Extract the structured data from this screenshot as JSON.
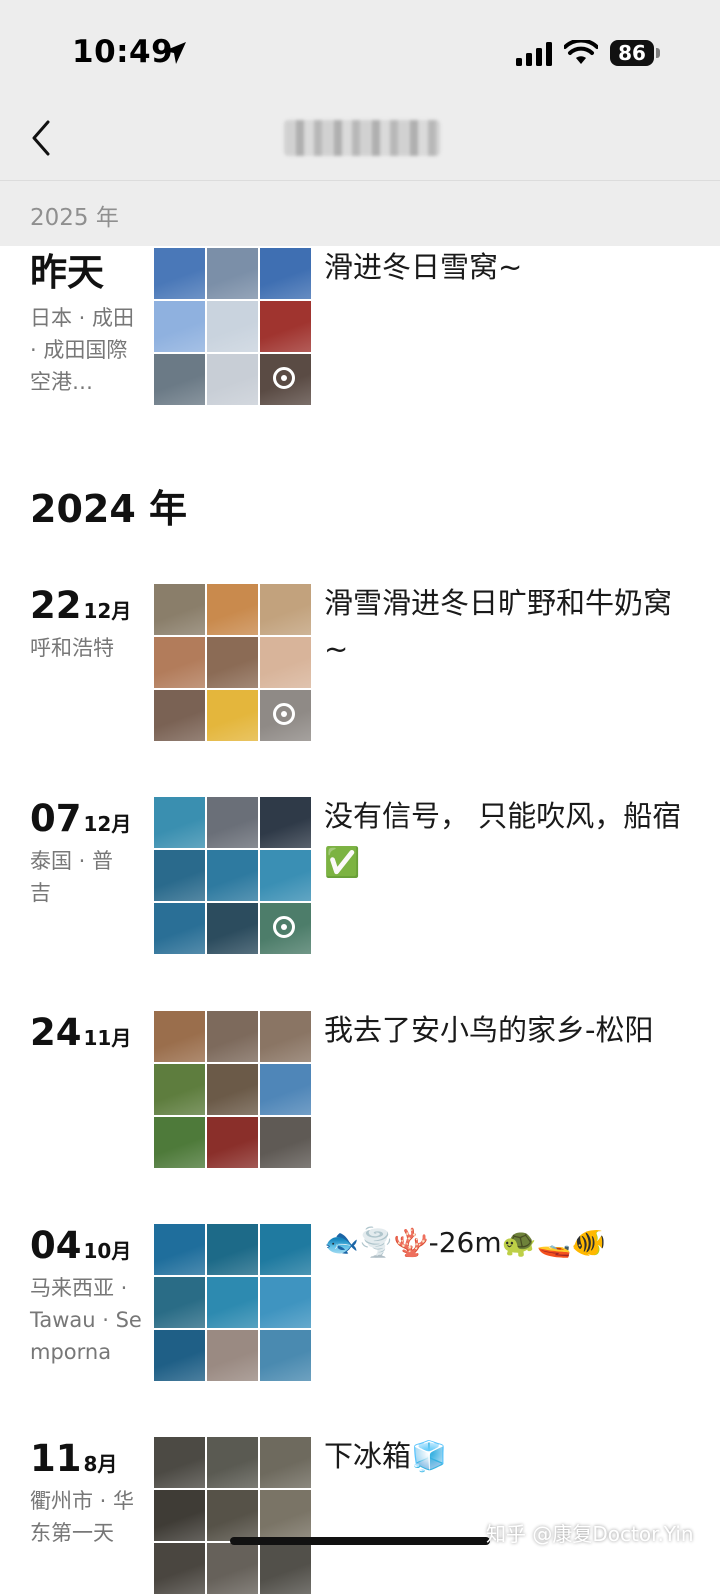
{
  "status_bar": {
    "time": "10:49",
    "battery": "86"
  },
  "nav": {
    "title": ""
  },
  "sticky_year": "2025 年",
  "colors": {
    "nav_background": "#ededed",
    "secondary_text": "#777777",
    "accent_green": "#3bb34a"
  },
  "section_2025": {
    "entries": [
      {
        "label": "昨天",
        "place": "日本 · 成田 · 成田国際空港…",
        "caption": "滑进冬日雪窝~",
        "tiles": [
          "#4a78b8",
          "#7b8fa8",
          "#3f6fb2",
          "#8fb1df",
          "#c9d3de",
          "#a0342f",
          "#6b7a86",
          "#c8ced6",
          "#5a4b44"
        ],
        "live_tile": 8
      }
    ]
  },
  "section_2024": {
    "year": "2024 年",
    "entries": [
      {
        "day": "22",
        "month": "12月",
        "place": "呼和浩特",
        "caption": "滑雪滑进冬日旷野和牛奶窝~",
        "tiles": [
          "#8a7e6a",
          "#c98a4d",
          "#c2a27d",
          "#b27c5b",
          "#8b6b55",
          "#d8b49a",
          "#7a6254",
          "#e4b63c",
          "#8f8a86"
        ],
        "live_tile": 8
      },
      {
        "day": "07",
        "month": "12月",
        "place": "泰国 · 普吉",
        "caption": "没有信号， 只能吹风，船宿✅",
        "tiles": [
          "#3a8fb0",
          "#6a6f78",
          "#2f3a48",
          "#2a6a8c",
          "#2e7aa0",
          "#3a8fb4",
          "#2a6f96",
          "#2c4c5e",
          "#4d7d6a"
        ],
        "live_tile": 8
      },
      {
        "day": "24",
        "month": "11月",
        "place": "",
        "caption": "我去了安小鸟的家乡-松阳",
        "tiles": [
          "#9a6e4c",
          "#7d6a5c",
          "#8a7564",
          "#5e7d3e",
          "#6b5a48",
          "#4f86b8",
          "#4e7a3a",
          "#8a2f2a",
          "#5f5a55"
        ],
        "live_tile": null
      },
      {
        "day": "04",
        "month": "10月",
        "place": "马来西亚 · Tawau · Semporna",
        "caption": "🐟🌪️🪸-26m🐢🚤🐠",
        "tiles": [
          "#1f6e9c",
          "#1d6a88",
          "#1f7aa0",
          "#2a6c86",
          "#2d8ab0",
          "#3f94c0",
          "#1f5f86",
          "#9a8a82",
          "#4a8ab0"
        ],
        "live_tile": null
      },
      {
        "day": "11",
        "month": "8月",
        "place": "衢州市 · 华东第一天",
        "caption": "下冰箱🧊",
        "tiles": [
          "#4c4a44",
          "#5a5a52",
          "#6e6a5e",
          "#3f3c36",
          "#565248",
          "#7a7466",
          "#4a4640",
          "#66615a",
          "#52504a"
        ],
        "live_tile": null
      }
    ]
  },
  "watermark": "知乎 @康复Doctor.Yin"
}
